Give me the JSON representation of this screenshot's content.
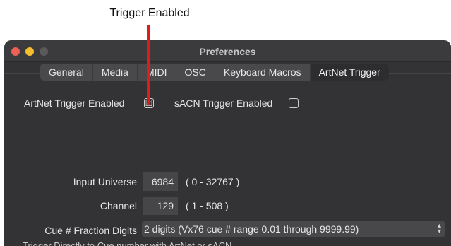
{
  "annotation": {
    "text": "Trigger Enabled",
    "arrow_color": "#e01b1b"
  },
  "window": {
    "title": "Preferences",
    "traffic_lights": {
      "close": "#ee5f55",
      "minimize": "#f4be2c",
      "zoom": "#5a5a5d"
    }
  },
  "tabs": [
    {
      "label": "General",
      "active": false
    },
    {
      "label": "Media",
      "active": false
    },
    {
      "label": "MIDI",
      "active": false
    },
    {
      "label": "OSC",
      "active": false
    },
    {
      "label": "Keyboard Macros",
      "active": false
    },
    {
      "label": "ArtNet Trigger",
      "active": true
    }
  ],
  "settings": {
    "artnet_enabled_label": "ArtNet Trigger Enabled",
    "artnet_enabled": true,
    "artnet_check_glyph": "☑",
    "sacn_enabled_label": "sACN Trigger Enabled",
    "sacn_enabled": false,
    "input_universe_label": "Input Universe",
    "input_universe_value": "6984",
    "input_universe_range": "( 0 - 32767 )",
    "channel_label": "Channel",
    "channel_value": "129",
    "channel_range": "( 1 - 508 )",
    "cue_fraction_label": "Cue # Fraction Digits",
    "cue_fraction_value": "2 digits (Vx76 cue # range 0.01 through 9999.99)",
    "cutoff_line": "Trigger Directly to Cue number with ArtNet or sACN"
  },
  "icons": {
    "chevron_updown": "updown-chevron-icon"
  }
}
